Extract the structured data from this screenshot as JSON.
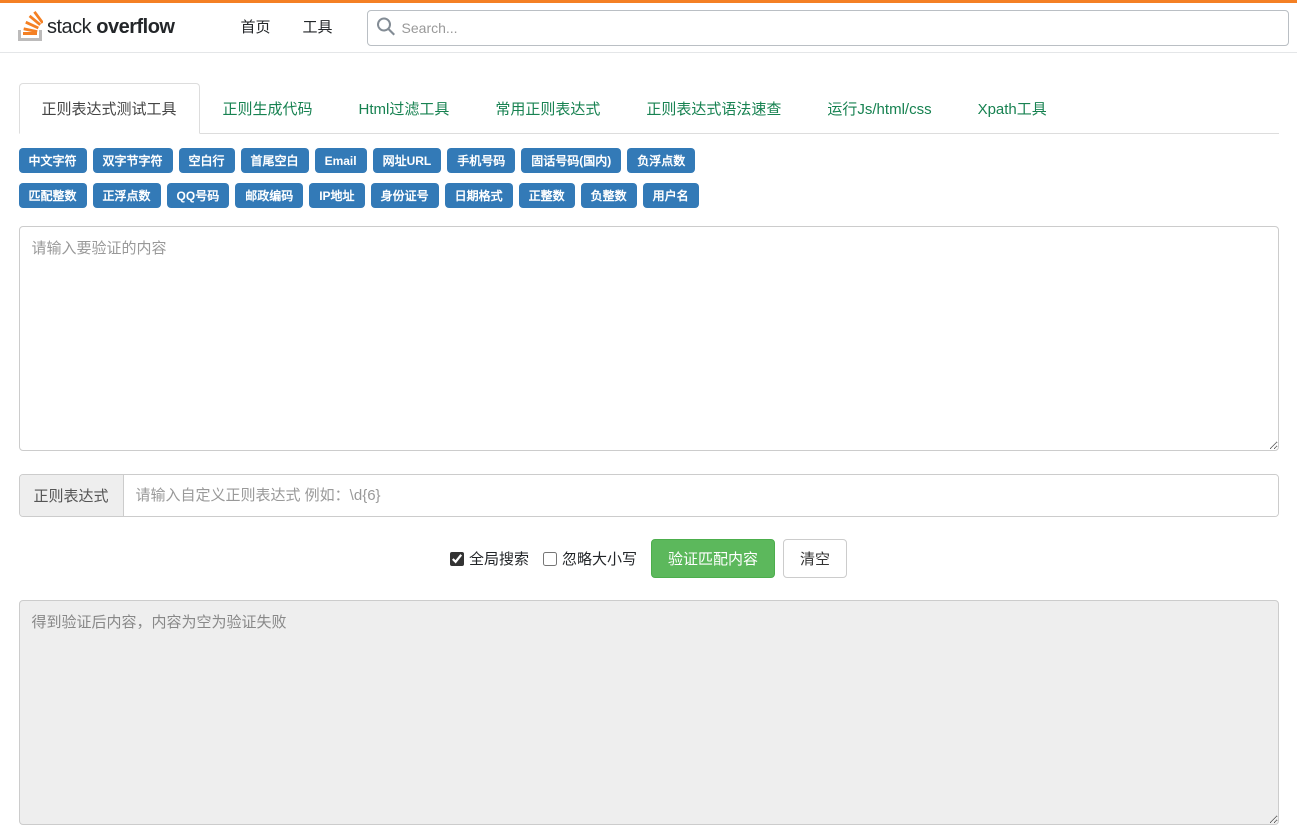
{
  "header": {
    "logo_text_light": "stack",
    "logo_text_bold": "overflow",
    "nav": [
      "首页",
      "工具"
    ],
    "search_placeholder": "Search..."
  },
  "tabs": [
    {
      "label": "正则表达式测试工具",
      "active": true
    },
    {
      "label": "正则生成代码",
      "active": false
    },
    {
      "label": "Html过滤工具",
      "active": false
    },
    {
      "label": "常用正则表达式",
      "active": false
    },
    {
      "label": "正则表达式语法速查",
      "active": false
    },
    {
      "label": "运行Js/html/css",
      "active": false
    },
    {
      "label": "Xpath工具",
      "active": false
    }
  ],
  "preset_tags_row1": [
    "中文字符",
    "双字节字符",
    "空白行",
    "首尾空白",
    "Email",
    "网址URL",
    "手机号码",
    "固话号码(国内)",
    "负浮点数"
  ],
  "preset_tags_row2": [
    "匹配整数",
    "正浮点数",
    "QQ号码",
    "邮政编码",
    "IP地址",
    "身份证号",
    "日期格式",
    "正整数",
    "负整数",
    "用户名"
  ],
  "content_placeholder": "请输入要验证的内容",
  "regex_label": "正则表达式",
  "regex_placeholder": "请输入自定义正则表达式 例如：\\d{6}",
  "controls": {
    "global_search": "全局搜索",
    "ignore_case": "忽略大小写",
    "global_checked": true,
    "ignore_checked": false,
    "validate_btn": "验证匹配内容",
    "clear_btn": "清空"
  },
  "result_placeholder": "得到验证后内容，内容为空为验证失败"
}
